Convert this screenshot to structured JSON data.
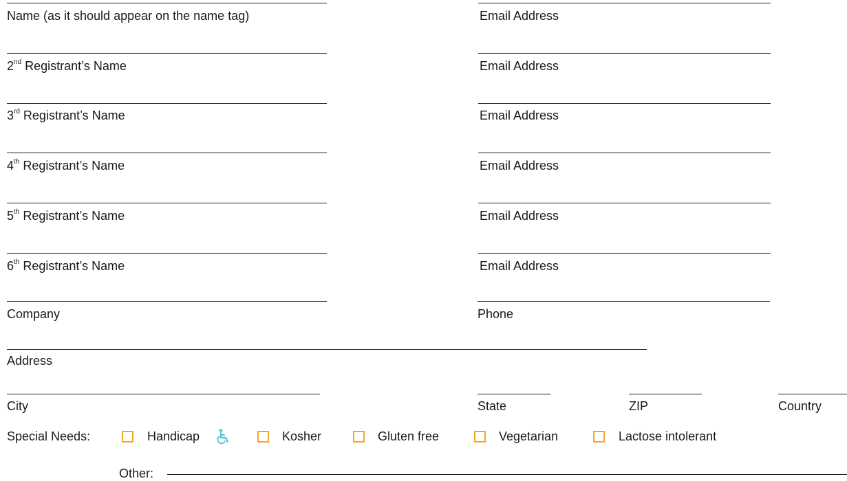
{
  "registrants": [
    {
      "name_label": "Name (as it should appear on the name tag)",
      "email_label": "Email Address"
    },
    {
      "ordinal": "2",
      "suffix": "nd",
      "name_rest": " Registrant’s Name",
      "email_label": "Email Address"
    },
    {
      "ordinal": "3",
      "suffix": "rd",
      "name_rest": " Registrant’s Name",
      "email_label": "Email Address"
    },
    {
      "ordinal": "4",
      "suffix": "th",
      "name_rest": " Registrant’s Name",
      "email_label": "Email Address"
    },
    {
      "ordinal": "5",
      "suffix": "th",
      "name_rest": " Registrant’s Name",
      "email_label": "Email Address"
    },
    {
      "ordinal": "6",
      "suffix": "th",
      "name_rest": " Registrant’s Name",
      "email_label": "Email Address"
    }
  ],
  "company_label": "Company",
  "phone_label": "Phone",
  "address_label": "Address",
  "city_label": "City",
  "state_label": "State",
  "zip_label": "ZIP",
  "country_label": "Country",
  "special_needs": {
    "label": "Special Needs:",
    "options": [
      "Handicap",
      "Kosher",
      "Gluten free",
      "Vegetarian",
      "Lactose intolerant"
    ],
    "other_label": "Other:"
  },
  "colors": {
    "checkbox": "#f5a623",
    "accessibility_icon": "#4ec4d3"
  },
  "icons": {
    "handicap": "wheelchair-icon"
  }
}
